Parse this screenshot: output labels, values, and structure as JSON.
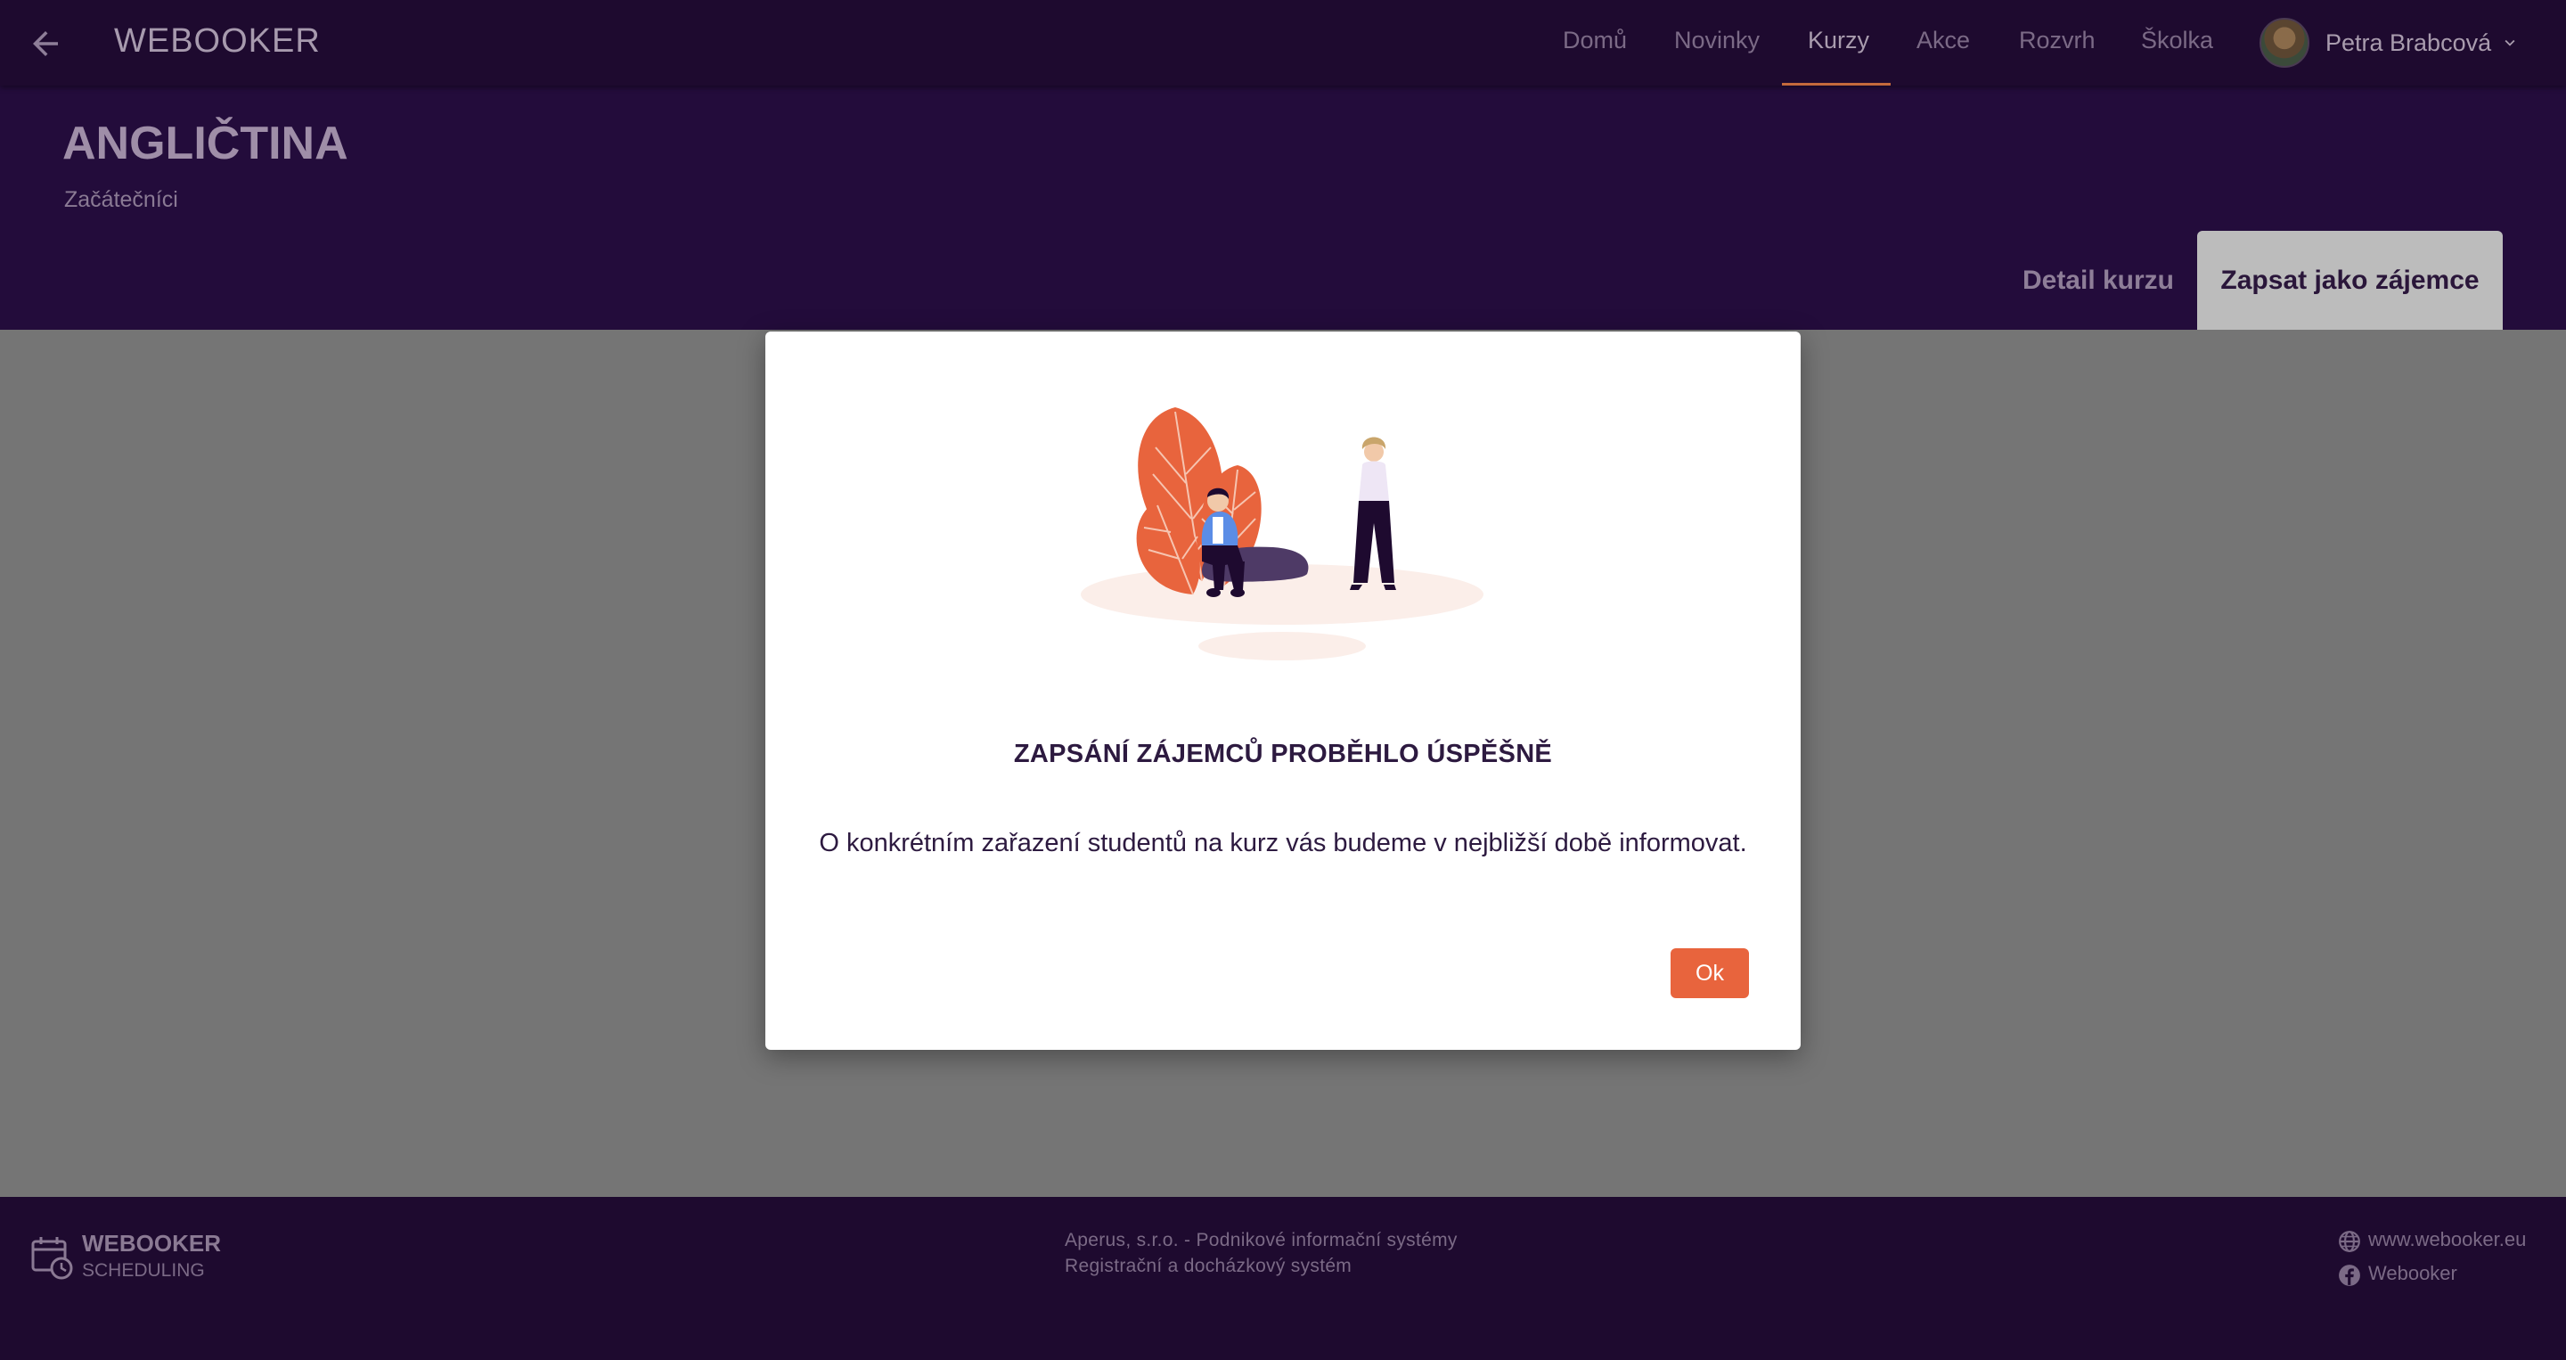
{
  "app": {
    "brand": "WEBOOKER"
  },
  "nav": {
    "items": [
      {
        "label": "Domů",
        "active": false
      },
      {
        "label": "Novinky",
        "active": false
      },
      {
        "label": "Kurzy",
        "active": true
      },
      {
        "label": "Akce",
        "active": false
      },
      {
        "label": "Rozvrh",
        "active": false
      },
      {
        "label": "Školka",
        "active": false
      }
    ]
  },
  "user": {
    "name": "Petra Brabcová"
  },
  "page": {
    "title": "ANGLIČTINA",
    "subtitle": "Začátečníci",
    "tabs": [
      {
        "label": "Detail kurzu",
        "selected": false
      },
      {
        "label": "Zapsat jako zájemce",
        "selected": true
      }
    ]
  },
  "modal": {
    "title": "ZAPSÁNÍ ZÁJEMCŮ PROBĚHLO ÚSPĚŠNĚ",
    "message": "O konkrétním zařazení studentů na kurz vás budeme v nejbližší době informovat.",
    "ok_label": "Ok"
  },
  "footer": {
    "logo_title": "WEBOOKER",
    "logo_subtitle": "SCHEDULING",
    "company": "Aperus, s.r.o. - Podnikové informační systémy",
    "product": "Registrační a docházkový systém",
    "website": "www.webooker.eu",
    "facebook": "Webooker"
  },
  "colors": {
    "header_bg": "#1e0a2f",
    "band_bg": "#230c3b",
    "accent": "#e8643d",
    "overlay": "#757575"
  },
  "icons": {
    "back": "arrow-left-icon",
    "chevron": "chevron-down-icon",
    "calendar": "calendar-clock-icon",
    "globe": "globe-icon",
    "facebook": "facebook-icon"
  }
}
